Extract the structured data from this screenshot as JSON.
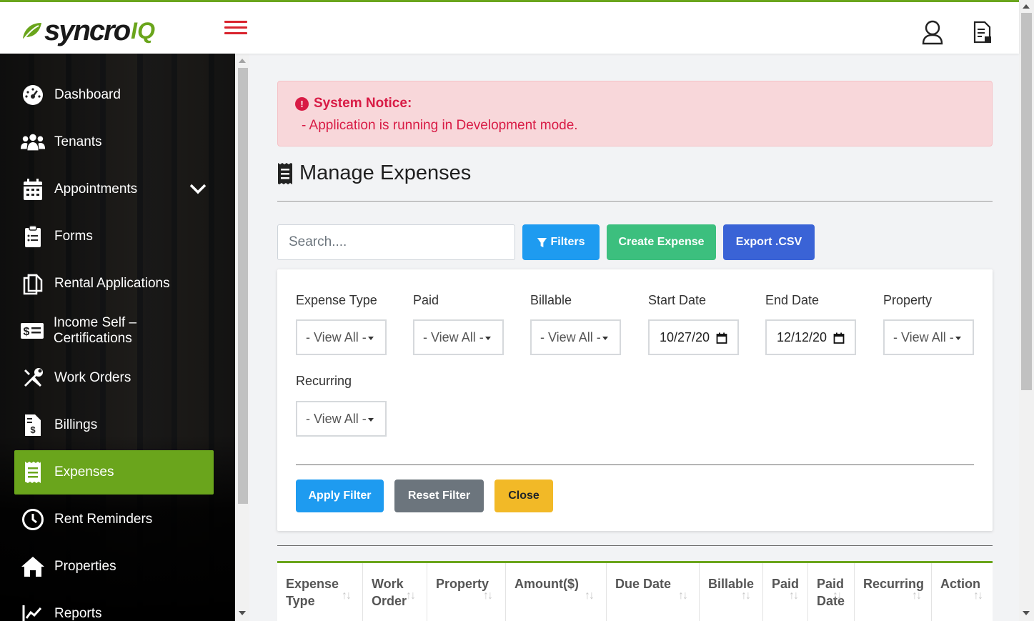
{
  "header": {
    "logo_word": "syncro",
    "logo_suffix": "IQ",
    "menu_icon": "hamburger-icon",
    "user_icon": "user-icon",
    "doc_icon": "document-icon"
  },
  "sidebar": {
    "items": [
      {
        "label": "Dashboard",
        "icon": "dashboard-gauge-icon"
      },
      {
        "label": "Tenants",
        "icon": "users-group-icon"
      },
      {
        "label": "Appointments",
        "icon": "calendar-icon",
        "expandable": true
      },
      {
        "label": "Forms",
        "icon": "clipboard-icon"
      },
      {
        "label": "Rental Applications",
        "icon": "copy-icon"
      },
      {
        "label": "Income Self – Certifications",
        "icon": "money-list-icon"
      },
      {
        "label": "Work Orders",
        "icon": "tools-icon"
      },
      {
        "label": "Billings",
        "icon": "invoice-dollar-icon"
      },
      {
        "label": "Expenses",
        "icon": "receipt-icon",
        "active": true
      },
      {
        "label": "Rent Reminders",
        "icon": "clock-icon"
      },
      {
        "label": "Properties",
        "icon": "home-icon"
      },
      {
        "label": "Reports",
        "icon": "chart-line-icon"
      }
    ],
    "active_color": "#6aa51c"
  },
  "notice": {
    "title": "System Notice:",
    "message": "- Application is running in Development mode."
  },
  "page": {
    "title": "Manage Expenses"
  },
  "toolbar": {
    "search_placeholder": "Search....",
    "filters_label": "Filters",
    "create_label": "Create Expense",
    "export_label": "Export .CSV"
  },
  "filters": {
    "expense_type": {
      "label": "Expense Type",
      "value": "- View All -"
    },
    "paid": {
      "label": "Paid",
      "value": "- View All -"
    },
    "billable": {
      "label": "Billable",
      "value": "- View All -"
    },
    "start_date": {
      "label": "Start Date",
      "value": "10/27/20"
    },
    "end_date": {
      "label": "End Date",
      "value": "12/12/20"
    },
    "property": {
      "label": "Property",
      "value": "- View All -"
    },
    "recurring": {
      "label": "Recurring",
      "value": "- View All -"
    },
    "apply_label": "Apply Filter",
    "reset_label": "Reset Filter",
    "close_label": "Close"
  },
  "table": {
    "columns": [
      {
        "line1": "Expense",
        "line2": "Type"
      },
      {
        "line1": "Work",
        "line2": "Order"
      },
      {
        "line1": "Property",
        "line2": ""
      },
      {
        "line1": "Amount($)",
        "line2": ""
      },
      {
        "line1": "Due Date",
        "line2": ""
      },
      {
        "line1": "Billable",
        "line2": ""
      },
      {
        "line1": "Paid",
        "line2": ""
      },
      {
        "line1": "Paid",
        "line2": "Date"
      },
      {
        "line1": "Recurring",
        "line2": ""
      },
      {
        "line1": "Action",
        "line2": ""
      }
    ]
  },
  "colors": {
    "brand_green": "#6aa51c",
    "notice_text": "#d81b45",
    "notice_bg": "#f8d7da",
    "primary": "#1e9bf0",
    "success": "#3cbf7e",
    "indigo": "#3a63d6",
    "secondary": "#6c757d",
    "warning": "#f2b927"
  }
}
